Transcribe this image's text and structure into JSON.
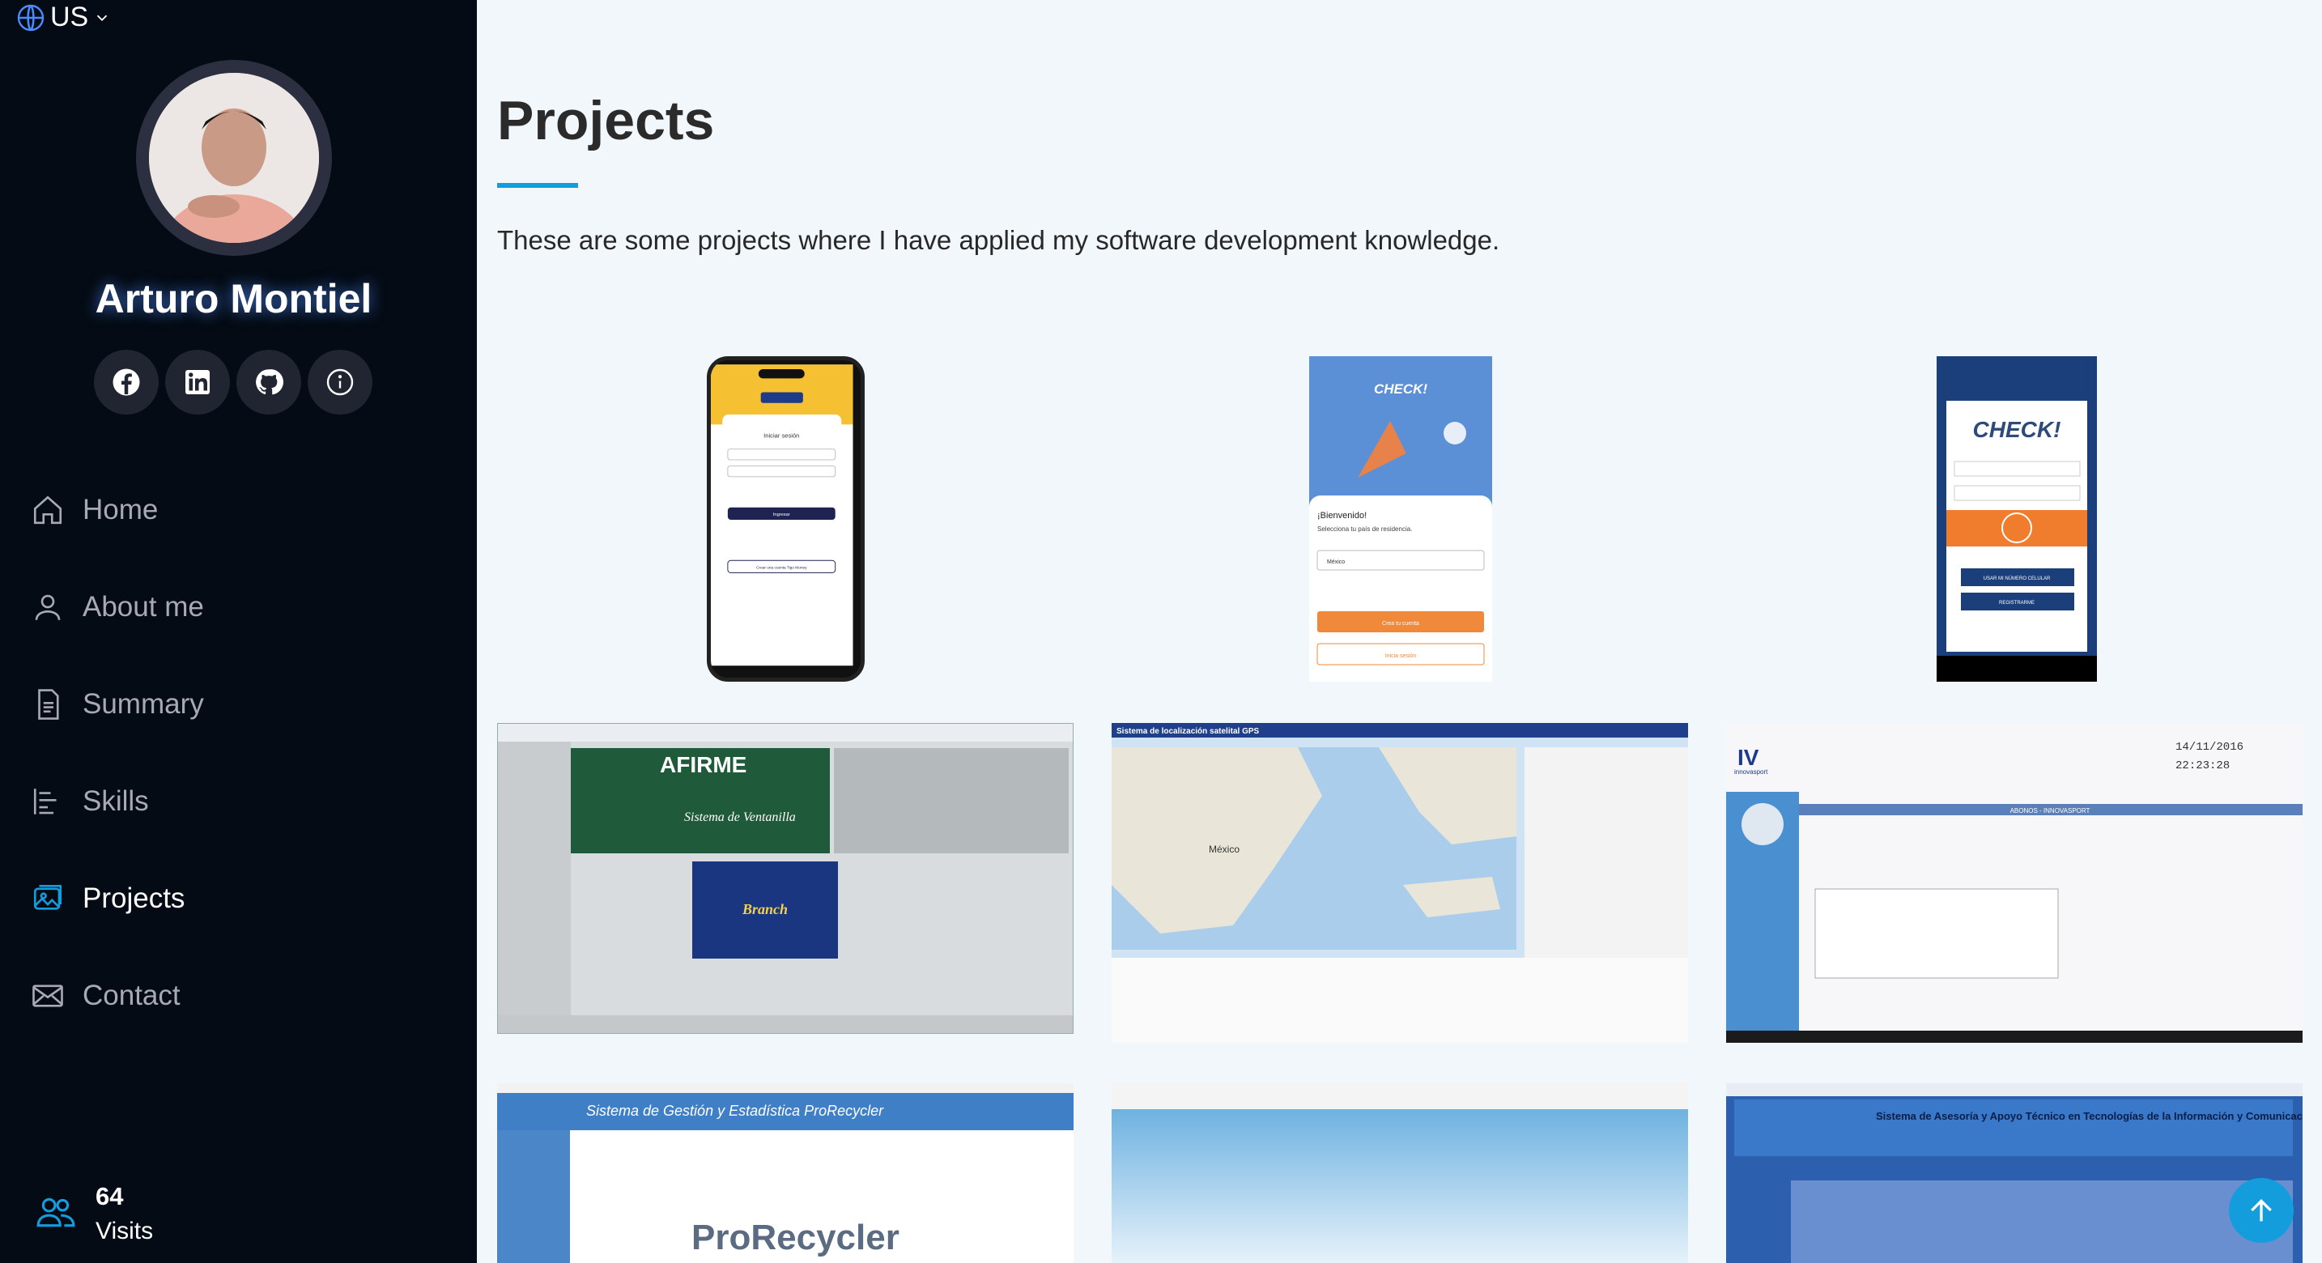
{
  "language": {
    "label": "US"
  },
  "profile": {
    "name": "Arturo Montiel"
  },
  "socials": [
    "facebook-icon",
    "linkedin-icon",
    "github-icon",
    "info-icon"
  ],
  "nav": [
    {
      "label": "Home",
      "icon": "house-icon"
    },
    {
      "label": "About me",
      "icon": "person-icon"
    },
    {
      "label": "Summary",
      "icon": "document-icon"
    },
    {
      "label": "Skills",
      "icon": "list-icon"
    },
    {
      "label": "Projects",
      "icon": "images-icon",
      "active": true
    },
    {
      "label": "Contact",
      "icon": "envelope-icon"
    }
  ],
  "visits": {
    "count": "64",
    "label": "Visits"
  },
  "main": {
    "title": "Projects",
    "description": "These are some projects where I have applied my software development knowledge."
  },
  "thumbnails": {
    "login_title": "Iniciar sesión",
    "login_button": "Ingresar",
    "login_create": "Crear una cuenta Tigo Money",
    "check_title": "CHECK!",
    "check_welcome": "¡Bienvenido!",
    "check_sub": "Selecciona tu país de residencia.",
    "check_country": "México",
    "check_create": "Crea tu cuenta",
    "check_login": "Inicia sesión",
    "check2_title": "CHECK!",
    "check2_phone": "USAR MI NÚMERO CELULAR",
    "check2_register": "REGISTRARME",
    "afirme_brand": "AFIRME",
    "afirme_system": "Sistema de Ventanilla",
    "afirme_branch": "Branch",
    "gps_title": "Sistema de localización satelital GPS",
    "gps_country": "México",
    "inno_title": "ABONOS - INNOVASPORT",
    "inno_date": "14/11/2016",
    "inno_time": "22:23:28",
    "inno_brand": "innovasport",
    "prorecycler_title": "Sistema de Gestión y Estadística ProRecycler",
    "prorecycler_logo": "ProRecycler",
    "saat_title": "Sistema de Asesoría y Apoyo Técnico en Tecnologías de la Información y Comunicación"
  },
  "colors": {
    "sidebar": "#040b14",
    "accent": "#149ddd",
    "background": "#f2f7fc"
  }
}
